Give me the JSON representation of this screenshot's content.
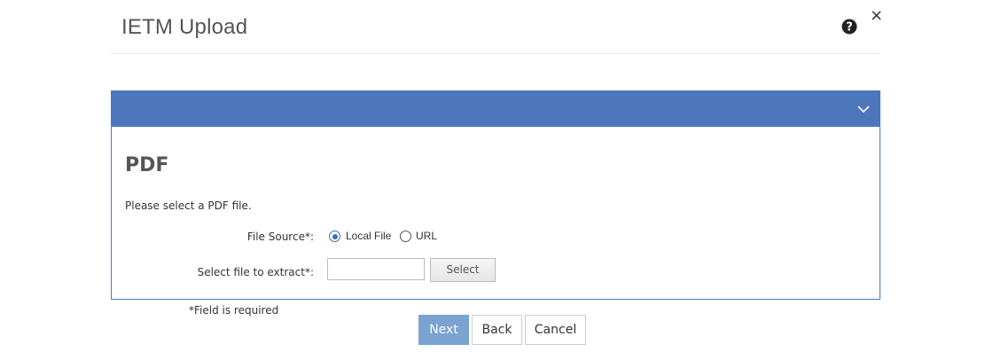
{
  "dialog": {
    "title": "IETM Upload",
    "close_glyph": "×",
    "help_icon": "question-circle-icon"
  },
  "panel": {
    "header_color": "#4c77bd",
    "collapse_icon": "chevron-down-icon",
    "section_title": "PDF",
    "instruction": "Please select a PDF file.",
    "file_source_label": "File Source*:",
    "file_source_options": [
      {
        "label": "Local File",
        "selected": true
      },
      {
        "label": "URL",
        "selected": false
      }
    ],
    "select_file_label": "Select file to extract*:",
    "file_input_value": "",
    "select_button_label": "Select"
  },
  "footer": {
    "required_note": "*Field is required",
    "next_label": "Next",
    "back_label": "Back",
    "cancel_label": "Cancel",
    "next_color": "#7aa3d1"
  }
}
